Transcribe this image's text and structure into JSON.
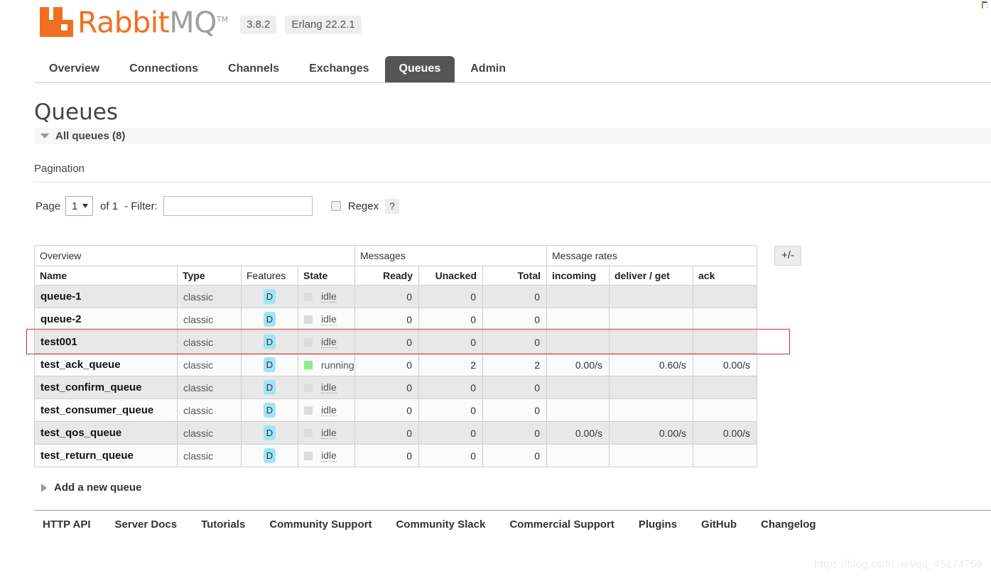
{
  "brand": {
    "name_part1": "Rabbit",
    "name_part2": "MQ",
    "trademark": "TM",
    "version": "3.8.2",
    "erlang": "Erlang 22.2.1",
    "logo_color": "#f26f21"
  },
  "nav": {
    "tabs": [
      {
        "label": "Overview",
        "active": false
      },
      {
        "label": "Connections",
        "active": false
      },
      {
        "label": "Channels",
        "active": false
      },
      {
        "label": "Exchanges",
        "active": false
      },
      {
        "label": "Queues",
        "active": true
      },
      {
        "label": "Admin",
        "active": false
      }
    ]
  },
  "page": {
    "title": "Queues",
    "section_label": "All queues (8)",
    "queue_count": 8
  },
  "pagination": {
    "title": "Pagination",
    "page_label": "Page",
    "page_value": "1",
    "page_options": [
      "1"
    ],
    "of_text": "of 1",
    "filter_label": "- Filter:",
    "filter_value": "",
    "filter_placeholder": "",
    "regex_label": "Regex",
    "regex_checked": false,
    "help_label": "?"
  },
  "table": {
    "toggle_columns_label": "+/-",
    "group_headers": [
      {
        "label": "Overview",
        "span": 4
      },
      {
        "label": "Messages",
        "span": 3
      },
      {
        "label": "Message rates",
        "span": 3
      }
    ],
    "columns": [
      {
        "label": "Name",
        "align": "left",
        "bold": true
      },
      {
        "label": "Type",
        "align": "left",
        "bold": true
      },
      {
        "label": "Features",
        "align": "left",
        "bold": false
      },
      {
        "label": "State",
        "align": "left",
        "bold": true
      },
      {
        "label": "Ready",
        "align": "right",
        "bold": true
      },
      {
        "label": "Unacked",
        "align": "right",
        "bold": true
      },
      {
        "label": "Total",
        "align": "right",
        "bold": true
      },
      {
        "label": "incoming",
        "align": "left",
        "bold": true
      },
      {
        "label": "deliver / get",
        "align": "left",
        "bold": true
      },
      {
        "label": "ack",
        "align": "left",
        "bold": true
      }
    ],
    "rows": [
      {
        "name": "queue-1",
        "type": "classic",
        "feature": "D",
        "state": "idle",
        "state_kind": "idle",
        "ready": "0",
        "unacked": "0",
        "total": "0",
        "incoming": "",
        "deliver_get": "",
        "ack": "",
        "highlighted": false
      },
      {
        "name": "queue-2",
        "type": "classic",
        "feature": "D",
        "state": "idle",
        "state_kind": "idle",
        "ready": "0",
        "unacked": "0",
        "total": "0",
        "incoming": "",
        "deliver_get": "",
        "ack": "",
        "highlighted": false
      },
      {
        "name": "test001",
        "type": "classic",
        "feature": "D",
        "state": "idle",
        "state_kind": "idle",
        "ready": "0",
        "unacked": "0",
        "total": "0",
        "incoming": "",
        "deliver_get": "",
        "ack": "",
        "highlighted": true
      },
      {
        "name": "test_ack_queue",
        "type": "classic",
        "feature": "D",
        "state": "running",
        "state_kind": "running",
        "ready": "0",
        "unacked": "2",
        "total": "2",
        "incoming": "0.00/s",
        "deliver_get": "0.60/s",
        "ack": "0.00/s",
        "highlighted": false
      },
      {
        "name": "test_confirm_queue",
        "type": "classic",
        "feature": "D",
        "state": "idle",
        "state_kind": "idle",
        "ready": "0",
        "unacked": "0",
        "total": "0",
        "incoming": "",
        "deliver_get": "",
        "ack": "",
        "highlighted": false
      },
      {
        "name": "test_consumer_queue",
        "type": "classic",
        "feature": "D",
        "state": "idle",
        "state_kind": "idle",
        "ready": "0",
        "unacked": "0",
        "total": "0",
        "incoming": "",
        "deliver_get": "",
        "ack": "",
        "highlighted": false
      },
      {
        "name": "test_qos_queue",
        "type": "classic",
        "feature": "D",
        "state": "idle",
        "state_kind": "idle",
        "ready": "0",
        "unacked": "0",
        "total": "0",
        "incoming": "0.00/s",
        "deliver_get": "0.00/s",
        "ack": "0.00/s",
        "highlighted": false
      },
      {
        "name": "test_return_queue",
        "type": "classic",
        "feature": "D",
        "state": "idle",
        "state_kind": "idle",
        "ready": "0",
        "unacked": "0",
        "total": "0",
        "incoming": "",
        "deliver_get": "",
        "ack": "",
        "highlighted": false
      }
    ]
  },
  "add_queue": {
    "label": "Add a new queue"
  },
  "footer": {
    "links": [
      "HTTP API",
      "Server Docs",
      "Tutorials",
      "Community Support",
      "Community Slack",
      "Commercial Support",
      "Plugins",
      "GitHub",
      "Changelog"
    ]
  },
  "watermark": {
    "text": "https://blog.csdn.net/qq_45174759"
  },
  "colors": {
    "brand_orange": "#f26f21",
    "active_tab_bg": "#555555",
    "durable_badge": "#9fe5f5",
    "state_running": "#8fec8f",
    "state_idle": "#dcdcdc",
    "annotation_red": "#d0312d"
  }
}
